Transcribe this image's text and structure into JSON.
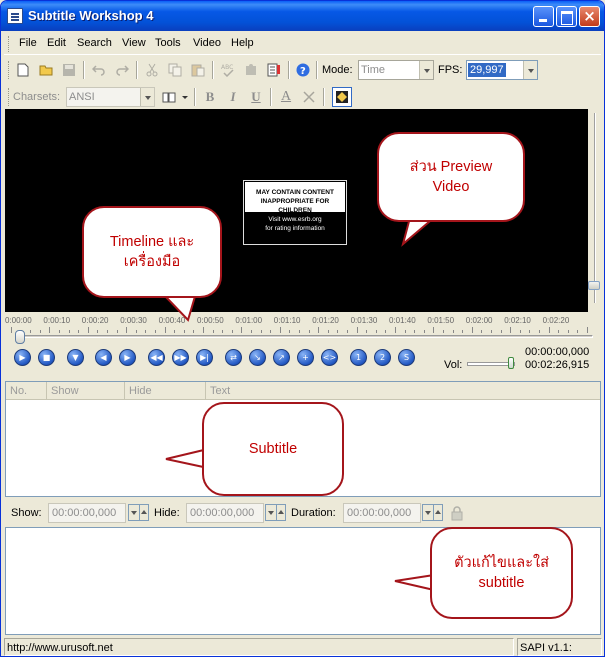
{
  "window": {
    "title": "Subtitle Workshop 4"
  },
  "menu": [
    "File",
    "Edit",
    "Search",
    "View",
    "Tools",
    "Video",
    "Help"
  ],
  "toolbar1": {
    "mode_label": "Mode:",
    "mode_value": "Time",
    "fps_label": "FPS:",
    "fps_value": "29,997"
  },
  "toolbar2": {
    "charsets_label": "Charsets:",
    "charset_value": "ANSI",
    "bold": "B",
    "italic": "I",
    "underline": "U",
    "font_color": "A"
  },
  "video": {
    "rating_top": "MAY CONTAIN CONTENT INAPPROPRIATE FOR CHILDREN",
    "rating_bottom_1": "Visit www.esrb.org",
    "rating_bottom_2": "for rating information"
  },
  "timeline": {
    "ticks": [
      "0:00:00",
      "0:00:10",
      "0:00:20",
      "0:00:30",
      "0:00:40",
      "0:00:50",
      "0:01:00",
      "0:01:10",
      "0:01:20",
      "0:01:30",
      "0:01:40",
      "0:01:50",
      "0:02:00",
      "0:02:10",
      "0:02:20"
    ],
    "position_fraction": 0.0
  },
  "playback": {
    "current_time": "00:00:00,000",
    "total_time": "00:02:26,915",
    "vol_label": "Vol:",
    "volume_fraction": 0.9
  },
  "grid": {
    "columns": [
      "No.",
      "Show",
      "Hide",
      "Text"
    ]
  },
  "editbar": {
    "show_label": "Show:",
    "show_value": "00:00:00,000",
    "hide_label": "Hide:",
    "hide_value": "00:00:00,000",
    "duration_label": "Duration:",
    "duration_value": "00:00:00,000"
  },
  "status": {
    "url": "http://www.urusoft.net",
    "version": "SAPI v1.1:"
  },
  "callouts": {
    "preview_1": "ส่วน Preview",
    "preview_2": "Video",
    "timeline_1": "Timeline และ",
    "timeline_2": "เครื่องมือ",
    "subtitle": "Subtitle",
    "editor_1": "ตัวแก้ไขและใส่",
    "editor_2": "subtitle"
  },
  "colors": {
    "titlebar": "#0752e1",
    "callout_border": "#a4151b",
    "callout_text": "#c00000",
    "play_button": "#2359c4"
  }
}
